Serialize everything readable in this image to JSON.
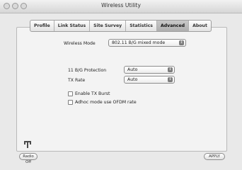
{
  "window": {
    "title": "Wireless Utility"
  },
  "tabs": [
    {
      "label": "Profile"
    },
    {
      "label": "Link Status"
    },
    {
      "label": "Site Survey"
    },
    {
      "label": "Statistics"
    },
    {
      "label": "Advanced",
      "active": true
    },
    {
      "label": "About"
    }
  ],
  "advanced": {
    "wireless_mode_label": "Wireless Mode",
    "wireless_mode_value": "802.11 B/G mixed mode",
    "protection_label": "11 B/G Protection",
    "protection_value": "Auto",
    "tx_rate_label": "TX Rate",
    "tx_rate_value": "Auto",
    "enable_tx_burst_label": "Enable TX Burst",
    "enable_tx_burst_checked": false,
    "adhoc_ofdm_label": "Adhoc mode use OFDM rate",
    "adhoc_ofdm_checked": false
  },
  "footer": {
    "radio_button_label": "Radio Off",
    "apply_button_label": "APPLY"
  },
  "icons": {
    "select_arrow": "updown-arrow-icon",
    "antenna": "antenna-icon"
  }
}
